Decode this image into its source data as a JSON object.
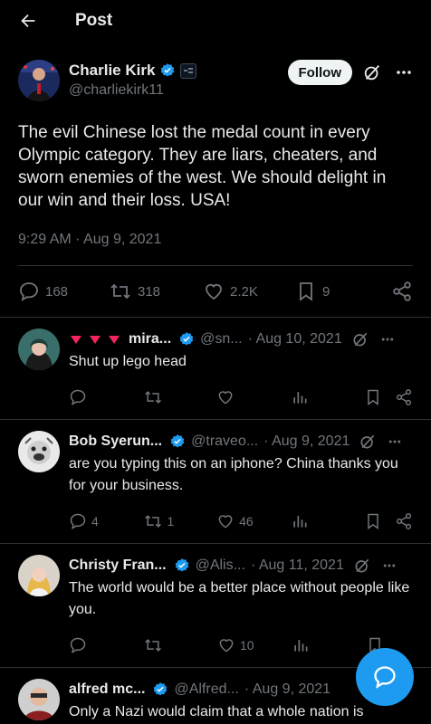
{
  "header": {
    "title": "Post"
  },
  "post": {
    "author_name": "Charlie Kirk",
    "author_handle": "@charliekirk11",
    "follow_label": "Follow",
    "text": "The evil Chinese lost the medal count in every Olympic category. They are liars, cheaters, and sworn enemies of the west. We should delight in our win and their loss. USA!",
    "timestamp": "9:29 AM · Aug 9, 2021",
    "replies": "168",
    "reposts": "318",
    "likes": "2.2K",
    "bookmarks": "9"
  },
  "replies": [
    {
      "name": "mira...",
      "handle": "@sn...",
      "date": "· Aug 10, 2021",
      "text": "Shut up lego head",
      "reply_count": "",
      "repost_count": "",
      "like_count": ""
    },
    {
      "name": "Bob Syerun...",
      "handle": "@traveo...",
      "date": "· Aug 9, 2021",
      "text": "are you typing this on an iphone?  China thanks you for your business.",
      "reply_count": "4",
      "repost_count": "1",
      "like_count": "46"
    },
    {
      "name": "Christy Fran...",
      "handle": "@Alis...",
      "date": "· Aug 11, 2021",
      "text": "The world would be a better place without people like you.",
      "reply_count": "",
      "repost_count": "",
      "like_count": "10"
    },
    {
      "name": "alfred mc...",
      "handle": "@Alfred...",
      "date": "· Aug 9, 2021",
      "text": "Only a Nazi would claim that a whole nation is"
    }
  ],
  "colors": {
    "accent": "#1d9bf0",
    "background": "#000000",
    "text": "#e7e9ea",
    "muted": "#71767b",
    "border": "#2f3336",
    "heart_emoji": "#f4245e"
  },
  "icons": [
    "back-arrow-icon",
    "verified-icon",
    "grok-icon",
    "more-icon",
    "reply-icon",
    "repost-icon",
    "like-icon",
    "bookmark-icon",
    "share-icon",
    "views-icon",
    "compose-reply-icon"
  ]
}
